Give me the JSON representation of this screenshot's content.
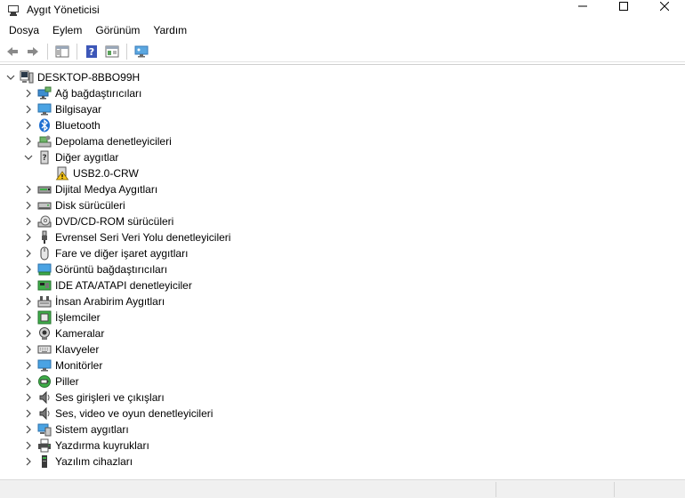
{
  "window": {
    "title": "Aygıt Yöneticisi"
  },
  "menu": [
    "Dosya",
    "Eylem",
    "Görünüm",
    "Yardım"
  ],
  "tree": {
    "root": "DESKTOP-8BBO99H",
    "categories": [
      {
        "label": "Ağ bağdaştırıcıları",
        "icon": "network-adapter-icon",
        "expanded": false
      },
      {
        "label": "Bilgisayar",
        "icon": "computer-icon",
        "expanded": false
      },
      {
        "label": "Bluetooth",
        "icon": "bluetooth-icon",
        "expanded": false
      },
      {
        "label": "Depolama denetleyicileri",
        "icon": "storage-controller-icon",
        "expanded": false
      },
      {
        "label": "Diğer aygıtlar",
        "icon": "other-devices-icon",
        "expanded": true,
        "children": [
          {
            "label": "USB2.0-CRW",
            "icon": "warning-device-icon"
          }
        ]
      },
      {
        "label": "Dijital Medya Aygıtları",
        "icon": "digital-media-icon",
        "expanded": false
      },
      {
        "label": "Disk sürücüleri",
        "icon": "disk-drive-icon",
        "expanded": false
      },
      {
        "label": "DVD/CD-ROM sürücüleri",
        "icon": "dvd-drive-icon",
        "expanded": false
      },
      {
        "label": "Evrensel Seri Veri Yolu denetleyicileri",
        "icon": "usb-controller-icon",
        "expanded": false
      },
      {
        "label": "Fare ve diğer işaret aygıtları",
        "icon": "mouse-icon",
        "expanded": false
      },
      {
        "label": "Görüntü bağdaştırıcıları",
        "icon": "display-adapter-icon",
        "expanded": false
      },
      {
        "label": "IDE ATA/ATAPI denetleyiciler",
        "icon": "ide-controller-icon",
        "expanded": false
      },
      {
        "label": "İnsan Arabirim Aygıtları",
        "icon": "hid-icon",
        "expanded": false
      },
      {
        "label": "İşlemciler",
        "icon": "processor-icon",
        "expanded": false
      },
      {
        "label": "Kameralar",
        "icon": "camera-icon",
        "expanded": false
      },
      {
        "label": "Klavyeler",
        "icon": "keyboard-icon",
        "expanded": false
      },
      {
        "label": "Monitörler",
        "icon": "monitor-icon",
        "expanded": false
      },
      {
        "label": "Piller",
        "icon": "battery-icon",
        "expanded": false
      },
      {
        "label": "Ses girişleri ve çıkışları",
        "icon": "audio-io-icon",
        "expanded": false
      },
      {
        "label": "Ses, video ve oyun denetleyicileri",
        "icon": "sound-video-icon",
        "expanded": false
      },
      {
        "label": "Sistem aygıtları",
        "icon": "system-devices-icon",
        "expanded": false
      },
      {
        "label": "Yazdırma kuyrukları",
        "icon": "print-queue-icon",
        "expanded": false
      },
      {
        "label": "Yazılım cihazları",
        "icon": "software-device-icon",
        "expanded": false
      }
    ]
  }
}
